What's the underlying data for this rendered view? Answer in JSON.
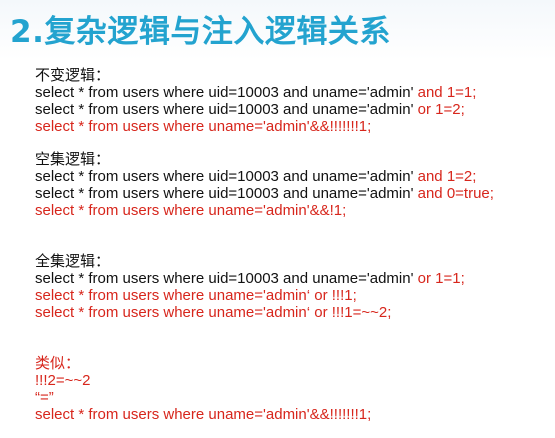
{
  "title": "2.复杂逻辑与注入逻辑关系",
  "sections": [
    {
      "heading": "不变逻辑：",
      "lines": [
        {
          "text": "select * from users where uid=10003 and uname='admin'",
          "tail": " and 1=1;"
        },
        {
          "text": "select * from users where uid=10003 and uname='admin'",
          "tail": " or 1=2;"
        },
        {
          "full": "select * from users where uname='admin'&&!!!!!!!1;"
        }
      ]
    },
    {
      "heading": "空集逻辑：",
      "lines": [
        {
          "text": "select * from users where uid=10003 and uname='admin'",
          "tail": " and 1=2;"
        },
        {
          "text": "select * from users where uid=10003 and uname='admin'",
          "tail": " and 0=true;"
        },
        {
          "full": "select * from users where uname='admin'&&!1;"
        }
      ]
    },
    {
      "heading": "全集逻辑：",
      "lines": [
        {
          "text": "select * from users where uid=10003 and uname='admin'",
          "tail": " or 1=1;"
        },
        {
          "full": "select * from users where uname='admin‘ or !!!1;"
        },
        {
          "full": "select * from users where uname='admin‘ or !!!1=~~2;"
        }
      ]
    },
    {
      "heading": "类似：",
      "lines": [
        {
          "full": "!!!2=~~2"
        },
        {
          "full": "“=”"
        },
        {
          "full": "select * from users where uname='admin'&&!!!!!!!1;"
        }
      ]
    }
  ]
}
